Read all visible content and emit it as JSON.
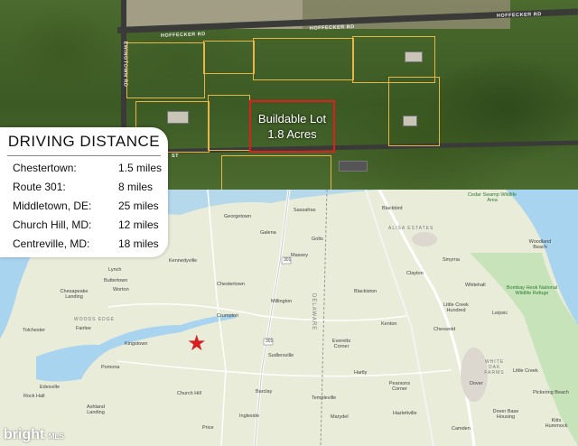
{
  "aerial": {
    "roads": [
      "HOFFECKER RD",
      "HOFFECKER RD",
      "HOFFECKER RD",
      "EWINGTOWN RD",
      "ST"
    ],
    "lot_label_line1": "Buildable Lot",
    "lot_label_line2": "1.8 Acres",
    "lot_border_color": "#e21d1d"
  },
  "driving": {
    "title": "DRIVING DISTANCE",
    "rows": [
      {
        "place": "Chestertown:",
        "distance": "1.5 miles"
      },
      {
        "place": "Route 301:",
        "distance": "8 miles"
      },
      {
        "place": "Middletown, DE:",
        "distance": "25 miles"
      },
      {
        "place": "Church Hill, MD:",
        "distance": "12 miles"
      },
      {
        "place": "Centreville, MD:",
        "distance": "18 miles"
      }
    ]
  },
  "map": {
    "towns": [
      "Georgetown",
      "Sassafras",
      "Blackbird",
      "Galena",
      "Golts",
      "Massey",
      "Kennedyville",
      "Lynch",
      "Buttertown",
      "Worton",
      "Chesapeake Landing",
      "Chestertown",
      "Millington",
      "Crumpton",
      "Blackiston",
      "Clayton",
      "Smyrna",
      "Whitehall",
      "Woodland Beach",
      "Bombay Hook National Wildlife Refuge",
      "Little Creek Hundred",
      "Leipsic",
      "Cheswold",
      "Kenton",
      "Tolchester",
      "Fairlee",
      "Kingstown",
      "Everetts Corner",
      "Sudlersville",
      "Hartly",
      "Little Creek",
      "Pomona",
      "Rock Hall",
      "Edesville",
      "Church Hill",
      "Barclay",
      "Pearsons Corner",
      "Dover",
      "Templeville",
      "Marydel",
      "Hazlettville",
      "Ashland Landing",
      "Price",
      "Ingleside",
      "Camden",
      "Dover Base Housing",
      "Kitts Hummock",
      "Pickering Beach",
      "Cedar Swamp Wildlife Area"
    ],
    "state_labels": [
      "DELAWARE",
      "ALISA ESTATES",
      "WOODS EDGE",
      "WHITE OAK FARMS"
    ],
    "route_shields": [
      "301",
      "301",
      "301"
    ],
    "marker_color": "#d61e1e"
  },
  "brand": {
    "name": "bright",
    "suffix": "MLS"
  }
}
